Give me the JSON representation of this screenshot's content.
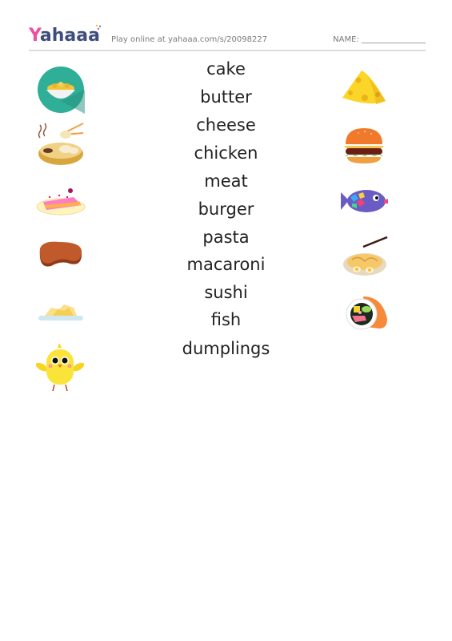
{
  "header": {
    "logo_first": "Y",
    "logo_rest": "ahaaa",
    "play_online": "Play online at yahaaa.com/s/20098227",
    "name_label": "NAME: ________________"
  },
  "words": [
    "cake",
    "butter",
    "cheese",
    "chicken",
    "meat",
    "burger",
    "pasta",
    "macaroni",
    "sushi",
    "fish",
    "dumplings"
  ],
  "left_images": [
    "macaroni-bowl",
    "dumplings",
    "cake",
    "meat-steak",
    "butter",
    "chicken"
  ],
  "right_images": [
    "cheese",
    "burger",
    "fish",
    "pasta",
    "sushi"
  ],
  "colors": {
    "logo_pink": "#ee4fa0",
    "logo_navy": "#3f4d7d",
    "teal": "#2fae98"
  }
}
